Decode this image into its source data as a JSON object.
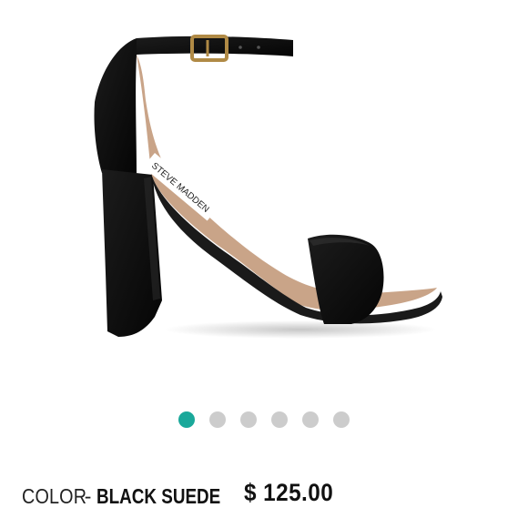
{
  "product": {
    "image_icon": "black-suede-block-heel-sandal-image",
    "insole_brand": "STEVE MADDEN",
    "color_label": "COLOR",
    "color_separator": "-",
    "color_value": "BLACK SUEDE",
    "price": "$ 125.00"
  },
  "carousel": {
    "total": 6,
    "active_index": 0,
    "active_color": "#1aa89a",
    "inactive_color": "#cccccc"
  }
}
